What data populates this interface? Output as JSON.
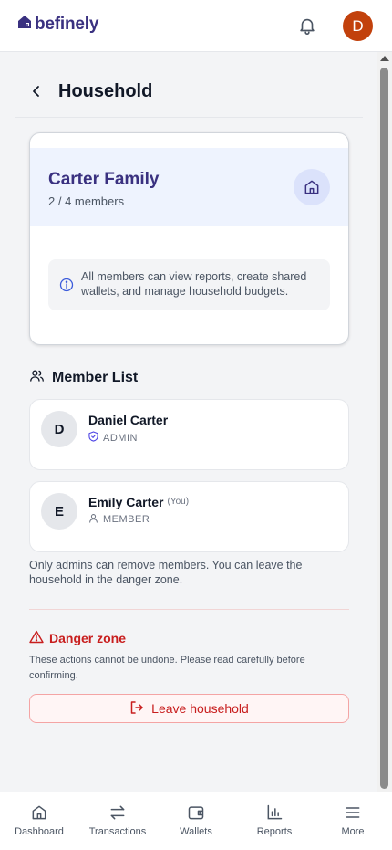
{
  "header": {
    "brand": "befinely",
    "avatar_initial": "D",
    "avatar_color": "#c2410c"
  },
  "page": {
    "title": "Household"
  },
  "household": {
    "name": "Carter Family",
    "member_count": "2 / 4 members",
    "info": "All members can view reports, create shared wallets, and manage household budgets."
  },
  "members_section": {
    "title": "Member List",
    "members": [
      {
        "initial": "D",
        "name": "Daniel Carter",
        "you_tag": "",
        "role": "ADMIN",
        "role_icon": "shield-icon"
      },
      {
        "initial": "E",
        "name": "Emily Carter",
        "you_tag": "(You)",
        "role": "MEMBER",
        "role_icon": "user-icon"
      }
    ],
    "note": "Only admins can remove members. You can leave the household in the danger zone."
  },
  "danger_zone": {
    "title": "Danger zone",
    "description": "These actions cannot be undone. Please read carefully before confirming.",
    "leave_label": "Leave household"
  },
  "bottom_nav": [
    {
      "label": "Dashboard",
      "icon": "home-icon"
    },
    {
      "label": "Transactions",
      "icon": "transfer-icon"
    },
    {
      "label": "Wallets",
      "icon": "wallet-icon"
    },
    {
      "label": "Reports",
      "icon": "bar-chart-icon"
    },
    {
      "label": "More",
      "icon": "menu-icon"
    }
  ],
  "colors": {
    "brand": "#3a3180",
    "danger": "#c81e1e",
    "household_header_bg": "#eef3fe"
  }
}
